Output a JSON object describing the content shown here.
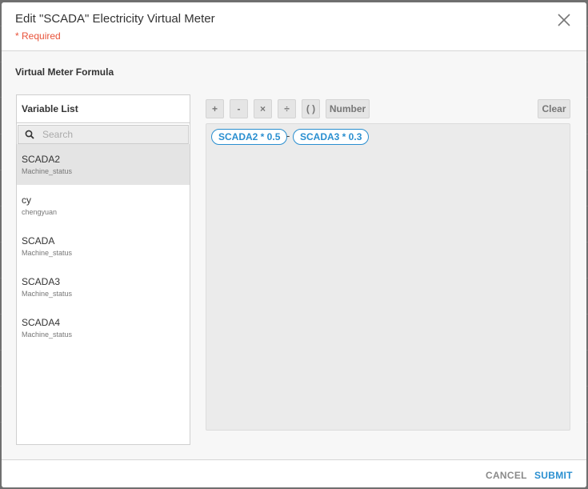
{
  "dialog": {
    "title": "Edit \"SCADA\" Electricity Virtual Meter",
    "required_note": "* Required",
    "close_icon": "close-icon"
  },
  "formula_section": {
    "label": "Virtual Meter Formula"
  },
  "variable_list": {
    "title": "Variable List",
    "search": {
      "placeholder": "Search",
      "value": ""
    },
    "items": [
      {
        "name": "SCADA2",
        "sub": "Machine_status",
        "selected": true
      },
      {
        "name": "cy",
        "sub": "chengyuan",
        "selected": false
      },
      {
        "name": "SCADA",
        "sub": "Machine_status",
        "selected": false
      },
      {
        "name": "SCADA3",
        "sub": "Machine_status",
        "selected": false
      },
      {
        "name": "SCADA4",
        "sub": "Machine_status",
        "selected": false
      }
    ]
  },
  "toolbar": {
    "plus": "+",
    "minus": "-",
    "multiply": "×",
    "divide": "÷",
    "parens": "( )",
    "number": "Number",
    "clear": "Clear"
  },
  "formula": {
    "tokens": [
      {
        "text": "SCADA2 * 0.5"
      },
      {
        "operator": "-"
      },
      {
        "text": "SCADA3 * 0.3"
      }
    ]
  },
  "footer": {
    "cancel": "CANCEL",
    "submit": "SUBMIT"
  },
  "colors": {
    "accent": "#2a8fd0",
    "required": "#e8533a",
    "backdrop": "#6f6f6f"
  }
}
